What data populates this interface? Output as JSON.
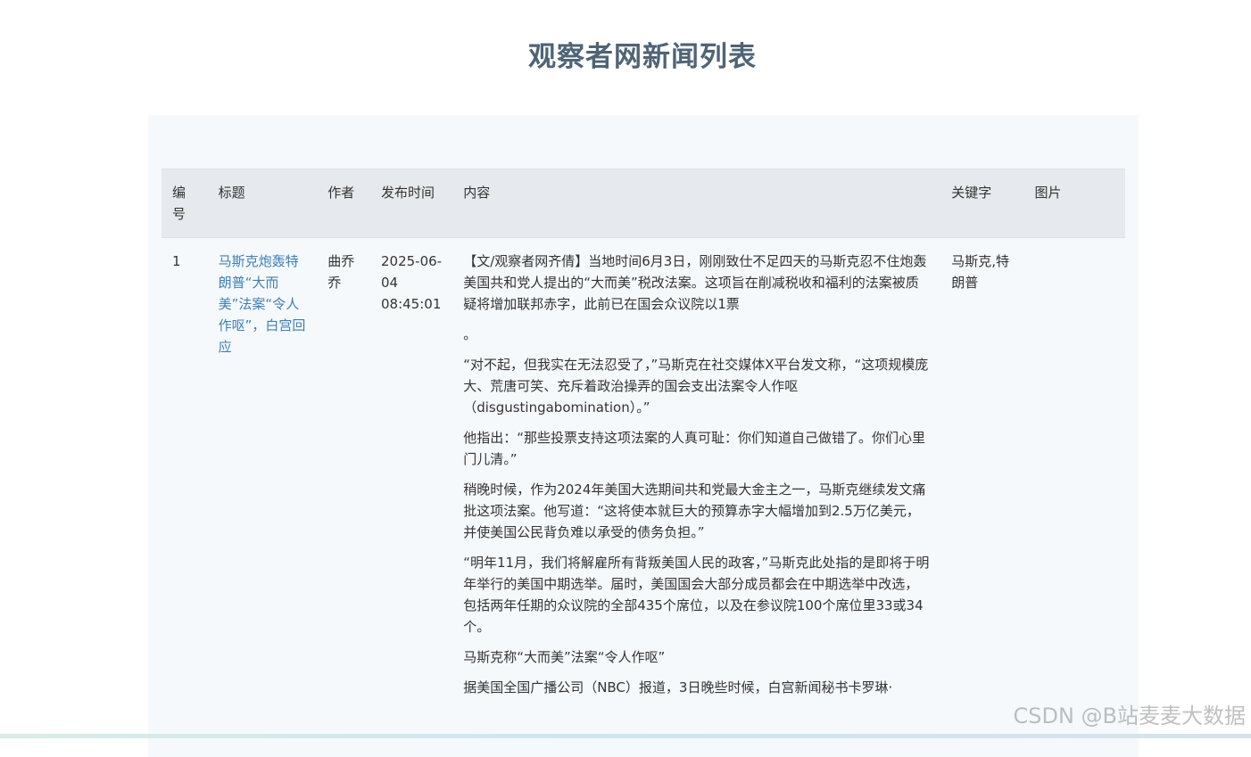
{
  "page": {
    "title": "观察者网新闻列表"
  },
  "table": {
    "headers": {
      "id": "编号",
      "title": "标题",
      "author": "作者",
      "time": "发布时间",
      "content": "内容",
      "keywords": "关键字",
      "image": "图片"
    },
    "rows": [
      {
        "id": "1",
        "title": "马斯克炮轰特朗普“大而美”法案“令人作呕”，白宫回应",
        "author": "曲乔乔",
        "time": "2025-06-04 08:45:01",
        "keywords": "马斯克,特朗普",
        "content": [
          "【文/观察者网齐倩】当地时间6月3日，刚刚致仕不足四天的马斯克忍不住炮轰美国共和党人提出的“大而美”税改法案。这项旨在削减税收和福利的法案被质疑将增加联邦赤字，此前已在国会众议院以1票",
          "。",
          "“对不起，但我实在无法忍受了，”马斯克在社交媒体X平台发文称，“这项规模庞大、荒唐可笑、充斥着政治操弄的国会支出法案令人作呕（disgustingabomination）。”",
          "他指出：“那些投票支持这项法案的人真可耻：你们知道自己做错了。你们心里门儿清。”",
          "稍晚时候，作为2024年美国大选期间共和党最大金主之一，马斯克继续发文痛批这项法案。他写道：“这将使本就巨大的预算赤字大幅增加到2.5万亿美元，并使美国公民背负难以承受的债务负担。”",
          "“明年11月，我们将解雇所有背叛美国人民的政客，”马斯克此处指的是即将于明年举行的美国中期选举。届时，美国国会大部分成员都会在中期选举中改选，包括两年任期的众议院的全部435个席位，以及在参议院100个席位里33或34个。",
          "马斯克称“大而美”法案“令人作呕”",
          "据美国全国广播公司（NBC）报道，3日晚些时候，白宫新闻秘书卡罗琳·"
        ]
      }
    ]
  },
  "watermark": {
    "text": "CSDN @B站麦麦大数据"
  }
}
